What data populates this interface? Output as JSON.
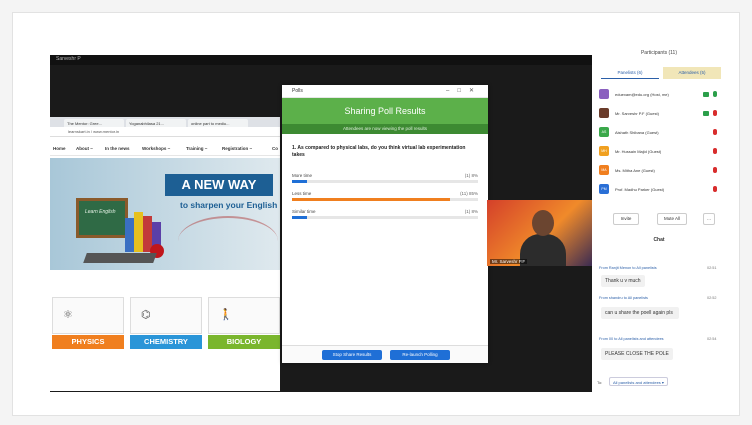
{
  "zoom": {
    "top_left": "Sarveshr P",
    "top_right": "",
    "browser": {
      "tabs": [
        "The Mentor: Gree...",
        "Yoganabhilasa 21...",
        "online part to mediu..."
      ],
      "url": "learnskart.in / www.mentor.in",
      "bookmarks": "Apps  e.learning  Cambridge",
      "nav": [
        "Home",
        "About ~",
        "In the news",
        "Workshops ~",
        "Training ~",
        "Registration ~",
        "Co"
      ],
      "hero_title": "A NEW WAY",
      "hero_sub": "to sharpen your English",
      "board_text": "Learn English",
      "subjects": [
        {
          "label": "PHYSICS",
          "icon": "atom-icon",
          "color": "#f07f1f"
        },
        {
          "label": "CHEMISTRY",
          "icon": "molecule-icon",
          "color": "#2a95d8"
        },
        {
          "label": "BIOLOGY",
          "icon": "evolution-icon",
          "color": "#7ab62d"
        }
      ]
    },
    "poll": {
      "window_title": "Polls",
      "header": "Sharing Poll Results",
      "subheader": "Attendees are now viewing the poll results",
      "question": "1. As compared to physical labs, do you think virtual lab experimentation takes",
      "options": [
        {
          "label": "More time",
          "percent_text": "(1) 8%",
          "fraction": 0.08,
          "color": "#1f6fd6"
        },
        {
          "label": "Less time",
          "percent_text": "(11) 85%",
          "fraction": 0.85,
          "color": "#f07f1f"
        },
        {
          "label": "Similar time",
          "percent_text": "(1) 8%",
          "fraction": 0.08,
          "color": "#1f6fd6"
        }
      ],
      "stop_button": "Stop Share Results",
      "relaunch_button": "Re-launch Polling"
    },
    "video_name": "Mr. Sarveshr P.F"
  },
  "panel": {
    "title": "Participants (11)",
    "tabs": [
      "Panelists (6)",
      "Attendees (5)"
    ],
    "participants": [
      {
        "initials": "",
        "name": "eduexam@edu.org (Host, me)",
        "color": "#8a5fbf",
        "mic": "#2b9f4a",
        "video": "#2b9f4a"
      },
      {
        "initials": "",
        "name": "Mr. Sarveshr P.F (Guest)",
        "color": "#6a3b2a",
        "mic": "#d82c2c",
        "video": "#2b9f4a"
      },
      {
        "initials": "AS",
        "name": "Aishath Shibana (Guest)",
        "color": "#3aa84a",
        "mic": "#d82c2c",
        "video": ""
      },
      {
        "initials": "MH",
        "name": "Mr. Hussain Majid (Guest)",
        "color": "#f0a020",
        "mic": "#d82c2c",
        "video": ""
      },
      {
        "initials": "MA",
        "name": "Ms. Mitha Ane (Guest)",
        "color": "#f07f1f",
        "mic": "#d82c2c",
        "video": ""
      },
      {
        "initials": "PM",
        "name": "Prof. Madhu Parker (Guest)",
        "color": "#2a6fd6",
        "mic": "#d82c2c",
        "video": ""
      }
    ],
    "invite": "Invite",
    "mute_all": "Mute All",
    "more": "...",
    "chat_title": "Chat",
    "messages": [
      {
        "meta": "From Ranjit Menon to All panelists",
        "time": "02:51",
        "text": "Thank u v much"
      },
      {
        "meta": "From shandru to All panelists",
        "time": "02:52",
        "text": "can u share the poell again pls"
      },
      {
        "meta": "From 00 to All panelists and attendees",
        "time": "02:54",
        "text": "PLEASE CLOSE THE POLE"
      }
    ],
    "to_label": "To:",
    "to_value": "All panelists and attendees ▾"
  }
}
